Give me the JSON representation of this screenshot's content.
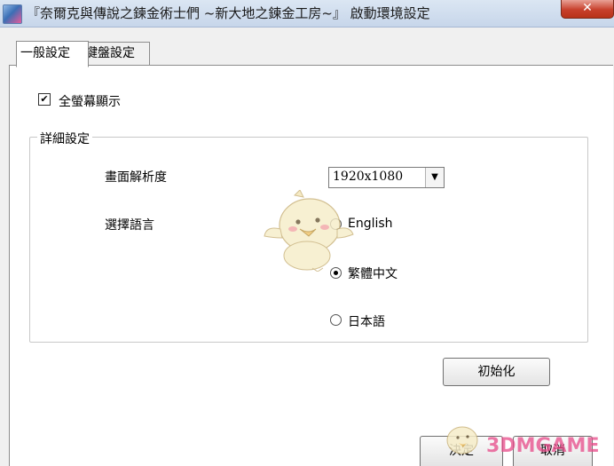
{
  "window": {
    "title": "『奈爾克與傳說之鍊金術士們 ~新大地之鍊金工房~』 啟動環境設定",
    "close_label": "✕"
  },
  "tabs": [
    {
      "label": "一般設定",
      "selected": true
    },
    {
      "label": "鍵盤設定",
      "selected": false
    }
  ],
  "general": {
    "fullscreen_label": "全螢幕顯示",
    "fullscreen_checked": true,
    "check_mark": "✔",
    "details_legend": "詳細設定",
    "resolution_label": "畫面解析度",
    "resolution_value": "1920x1080",
    "language_label": "選擇語言",
    "languages": [
      {
        "label": "English",
        "selected": false
      },
      {
        "label": "繁體中文",
        "selected": true
      },
      {
        "label": "日本語",
        "selected": false
      }
    ],
    "reset_label": "初始化"
  },
  "footer": {
    "confirm_label": "決定",
    "cancel_label": "取消"
  },
  "watermark": {
    "logo": "3DMGAME",
    "accent": "#e74a89"
  },
  "colors": {
    "titlebar": "#c7d6ea",
    "close": "#c7402c",
    "panel": "#ffffff",
    "background": "#f0f0f0"
  }
}
